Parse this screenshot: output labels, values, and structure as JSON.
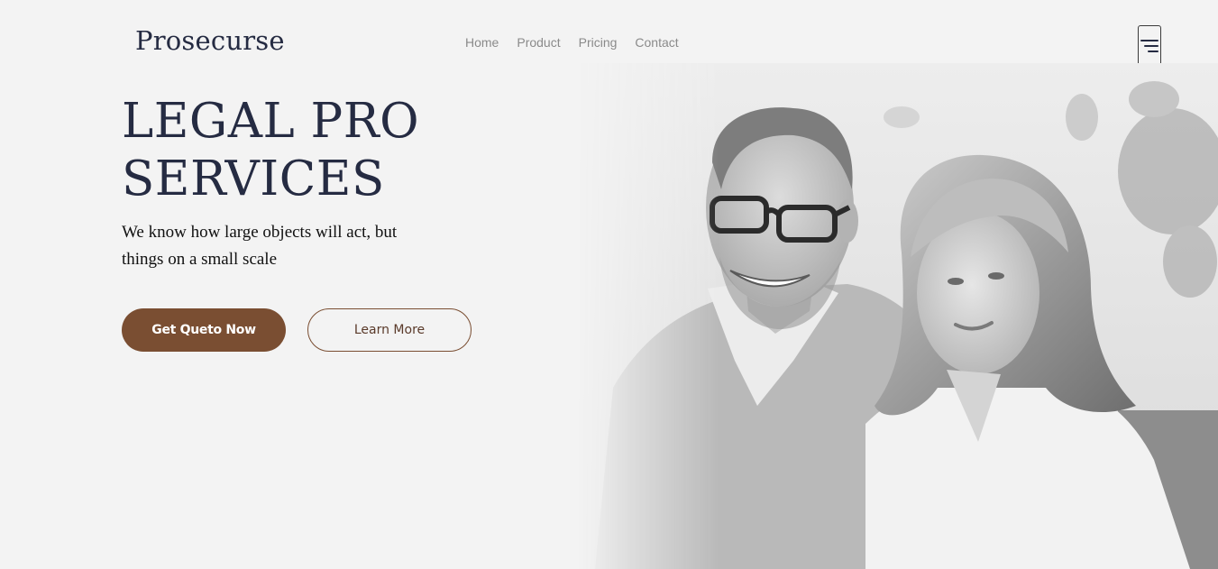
{
  "brand": {
    "logo": "Prosecurse"
  },
  "nav": {
    "items": [
      {
        "label": "Home"
      },
      {
        "label": "Product"
      },
      {
        "label": "Pricing"
      },
      {
        "label": "Contact"
      }
    ]
  },
  "hero": {
    "title_line1": "LEGAL PRO",
    "title_line2": "SERVICES",
    "subtitle": "We know how large objects will act, but things on a small scale",
    "primary_button": "Get Queto Now",
    "secondary_button": "Learn More",
    "image_icon": "couple-photo"
  },
  "menu": {
    "icon": "hamburger-menu-icon"
  },
  "colors": {
    "background": "#f3f3f3",
    "heading": "#252b42",
    "accent": "#7a4e32",
    "nav_text": "#8a8a8a"
  }
}
